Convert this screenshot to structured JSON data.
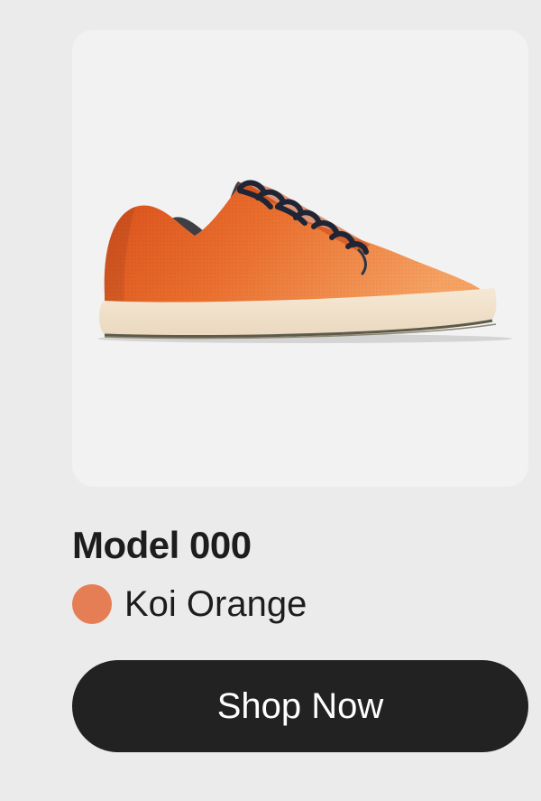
{
  "product": {
    "image_alt": "orange knit sneaker with cream sole and navy laces",
    "name": "Model 000",
    "color_name": "Koi Orange",
    "swatch_color": "#e67e55"
  },
  "cta": {
    "label": "Shop Now"
  },
  "colors": {
    "background": "#ebebeb",
    "card": "#f2f2f2",
    "text": "#1d1d1d",
    "button": "#222222",
    "button_text": "#ffffff"
  }
}
